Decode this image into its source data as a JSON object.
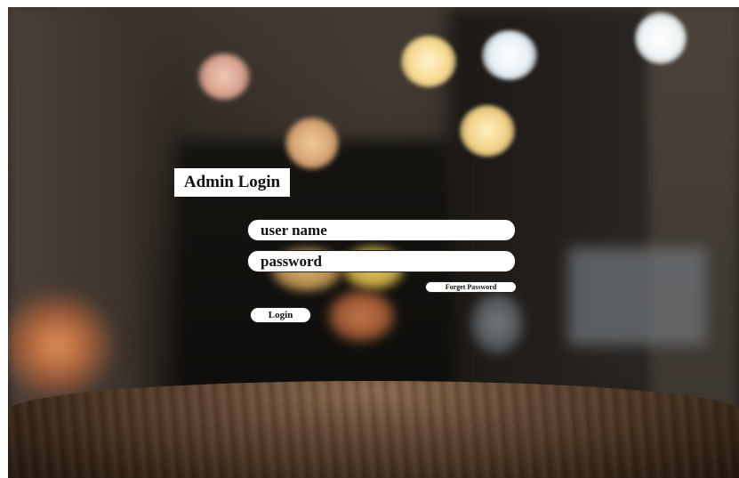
{
  "page": {
    "title": "Admin Login"
  },
  "form": {
    "username_placeholder": "user name",
    "username_value": "",
    "password_placeholder": "password",
    "password_value": "",
    "forget_label": "Forget Password",
    "login_label": "Login"
  },
  "colors": {
    "background_dark": "#2a241f",
    "table_wood": "#5f4431",
    "field_bg": "#ffffff",
    "text": "#111111",
    "bokeh_warm": "#f4d9a6",
    "bokeh_cool": "#e9f2f8"
  }
}
